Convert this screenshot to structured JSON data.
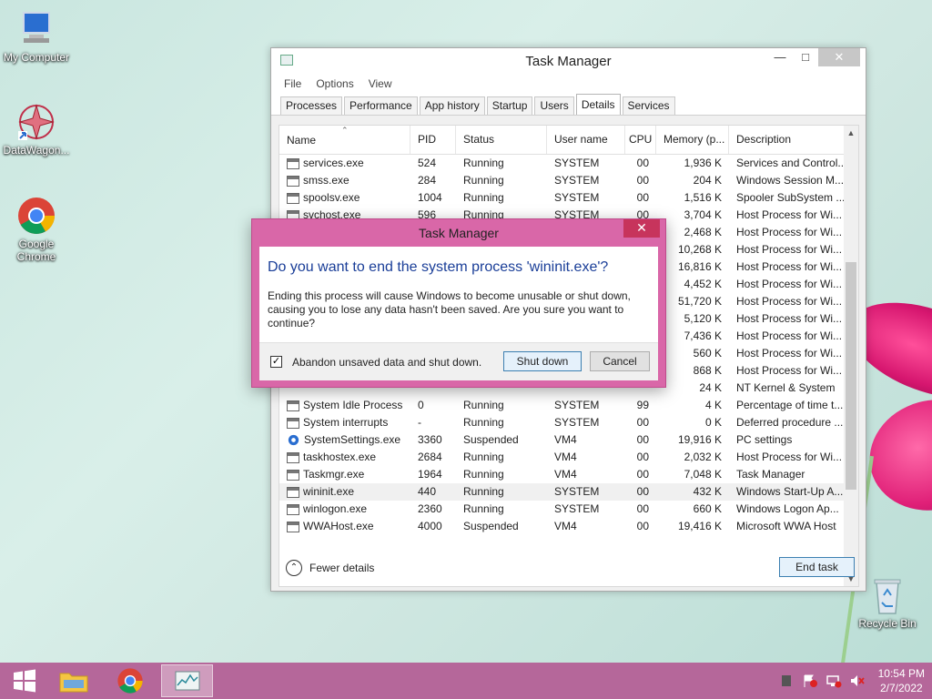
{
  "desktop": {
    "icons": [
      {
        "label": "My Computer"
      },
      {
        "label": "DataWagon..."
      },
      {
        "label": "Google Chrome"
      },
      {
        "label": "Recycle Bin"
      }
    ]
  },
  "window": {
    "title": "Task Manager",
    "menu": [
      "File",
      "Options",
      "View"
    ],
    "tabs": [
      "Processes",
      "Performance",
      "App history",
      "Startup",
      "Users",
      "Details",
      "Services"
    ],
    "active_tab": "Details",
    "columns": [
      "Name",
      "PID",
      "Status",
      "User name",
      "CPU",
      "Memory (p...",
      "Description"
    ],
    "rows": [
      {
        "name": "services.exe",
        "pid": "524",
        "status": "Running",
        "user": "SYSTEM",
        "cpu": "00",
        "mem": "1,936 K",
        "desc": "Services and Control..."
      },
      {
        "name": "smss.exe",
        "pid": "284",
        "status": "Running",
        "user": "SYSTEM",
        "cpu": "00",
        "mem": "204 K",
        "desc": "Windows Session M..."
      },
      {
        "name": "spoolsv.exe",
        "pid": "1004",
        "status": "Running",
        "user": "SYSTEM",
        "cpu": "00",
        "mem": "1,516 K",
        "desc": "Spooler SubSystem ..."
      },
      {
        "name": "svchost.exe",
        "pid": "596",
        "status": "Running",
        "user": "SYSTEM",
        "cpu": "00",
        "mem": "3,704 K",
        "desc": "Host Process for Wi..."
      },
      {
        "name": "",
        "pid": "",
        "status": "",
        "user": "",
        "cpu": "",
        "mem": "2,468 K",
        "desc": "Host Process for Wi..."
      },
      {
        "name": "",
        "pid": "",
        "status": "",
        "user": "",
        "cpu": "",
        "mem": "10,268 K",
        "desc": "Host Process for Wi..."
      },
      {
        "name": "",
        "pid": "",
        "status": "",
        "user": "",
        "cpu": "",
        "mem": "16,816 K",
        "desc": "Host Process for Wi..."
      },
      {
        "name": "",
        "pid": "",
        "status": "",
        "user": "",
        "cpu": "",
        "mem": "4,452 K",
        "desc": "Host Process for Wi..."
      },
      {
        "name": "",
        "pid": "",
        "status": "",
        "user": "",
        "cpu": "",
        "mem": "51,720 K",
        "desc": "Host Process for Wi..."
      },
      {
        "name": "",
        "pid": "",
        "status": "",
        "user": "",
        "cpu": "",
        "mem": "5,120 K",
        "desc": "Host Process for Wi..."
      },
      {
        "name": "",
        "pid": "",
        "status": "",
        "user": "",
        "cpu": "",
        "mem": "7,436 K",
        "desc": "Host Process for Wi..."
      },
      {
        "name": "",
        "pid": "",
        "status": "",
        "user": "",
        "cpu": "",
        "mem": "560 K",
        "desc": "Host Process for Wi..."
      },
      {
        "name": "",
        "pid": "",
        "status": "",
        "user": "",
        "cpu": "",
        "mem": "868 K",
        "desc": "Host Process for Wi..."
      },
      {
        "name": "",
        "pid": "",
        "status": "",
        "user": "",
        "cpu": "",
        "mem": "24 K",
        "desc": "NT Kernel & System"
      },
      {
        "name": "System Idle Process",
        "pid": "0",
        "status": "Running",
        "user": "SYSTEM",
        "cpu": "99",
        "mem": "4 K",
        "desc": "Percentage of time t..."
      },
      {
        "name": "System interrupts",
        "pid": "-",
        "status": "Running",
        "user": "SYSTEM",
        "cpu": "00",
        "mem": "0 K",
        "desc": "Deferred procedure ..."
      },
      {
        "name": "SystemSettings.exe",
        "pid": "3360",
        "status": "Suspended",
        "user": "VM4",
        "cpu": "00",
        "mem": "19,916 K",
        "desc": "PC settings"
      },
      {
        "name": "taskhostex.exe",
        "pid": "2684",
        "status": "Running",
        "user": "VM4",
        "cpu": "00",
        "mem": "2,032 K",
        "desc": "Host Process for Wi..."
      },
      {
        "name": "Taskmgr.exe",
        "pid": "1964",
        "status": "Running",
        "user": "VM4",
        "cpu": "00",
        "mem": "7,048 K",
        "desc": "Task Manager"
      },
      {
        "name": "wininit.exe",
        "pid": "440",
        "status": "Running",
        "user": "SYSTEM",
        "cpu": "00",
        "mem": "432 K",
        "desc": "Windows Start-Up A..."
      },
      {
        "name": "winlogon.exe",
        "pid": "2360",
        "status": "Running",
        "user": "SYSTEM",
        "cpu": "00",
        "mem": "660 K",
        "desc": "Windows Logon Ap..."
      },
      {
        "name": "WWAHost.exe",
        "pid": "4000",
        "status": "Suspended",
        "user": "VM4",
        "cpu": "00",
        "mem": "19,416 K",
        "desc": "Microsoft WWA Host"
      }
    ],
    "fewer_details": "Fewer details",
    "end_task": "End task"
  },
  "dialog": {
    "title": "Task Manager",
    "heading": "Do you want to end the system process 'wininit.exe'?",
    "text": "Ending this process will cause Windows to become unusable or shut down, causing you to lose any data hasn't been saved. Are you sure you want to continue?",
    "checkbox_label": "Abandon unsaved data and shut down.",
    "checkbox_checked": true,
    "shutdown_label": "Shut down",
    "cancel_label": "Cancel"
  },
  "taskbar": {
    "time": "10:54 PM",
    "date": "2/7/2022"
  },
  "colors": {
    "accent": "#d967a8",
    "taskbar": "#b5679a",
    "heading": "#1a3e98"
  }
}
